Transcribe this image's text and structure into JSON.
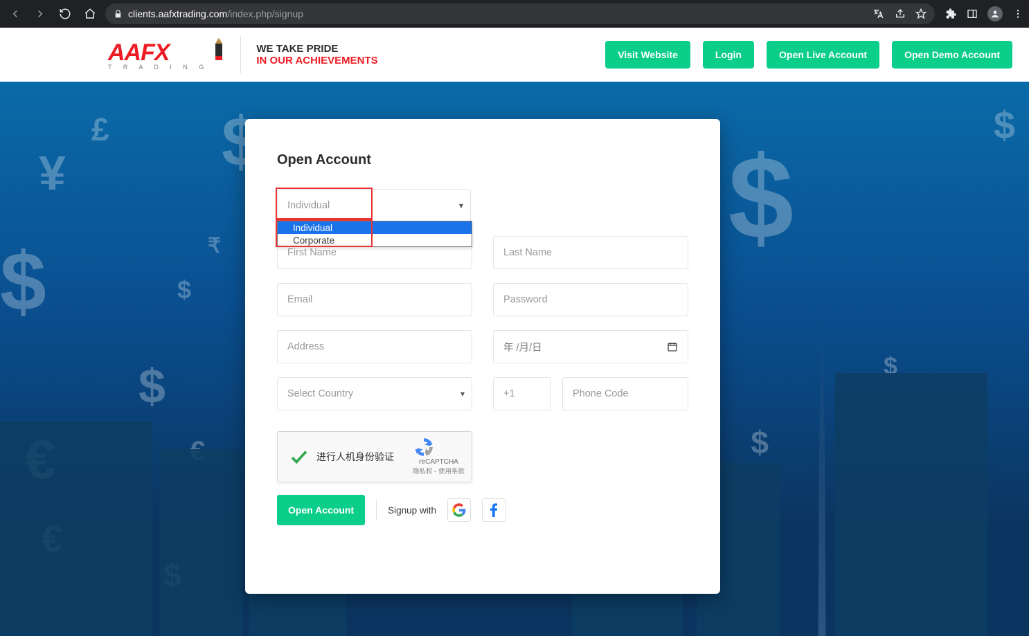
{
  "browser": {
    "url_host": "clients.aafxtrading.com",
    "url_path": "/index.php/signup"
  },
  "header": {
    "logo_text": "AAFX",
    "logo_sub": "T R A D I N G",
    "tagline1": "WE TAKE PRIDE",
    "tagline2": "IN OUR ACHIEVEMENTS",
    "buttons": {
      "visit": "Visit Website",
      "login": "Login",
      "open_live": "Open Live Account",
      "open_demo": "Open Demo Account"
    }
  },
  "form": {
    "title": "Open Account",
    "account_type": {
      "selected": "Individual",
      "options": [
        "Individual",
        "Corporate"
      ]
    },
    "placeholders": {
      "first_name": "First Name",
      "last_name": "Last Name",
      "email": "Email",
      "password": "Password",
      "address": "Address",
      "date": "年 /月/日",
      "country": "Select Country",
      "dial_code": "+1",
      "phone": "Phone Code"
    },
    "captcha": {
      "label": "进行人机身份验证",
      "brand": "reCAPTCHA",
      "terms": "隐私权 - 使用条款"
    },
    "submit": "Open Account",
    "signup_with": "Signup with"
  }
}
